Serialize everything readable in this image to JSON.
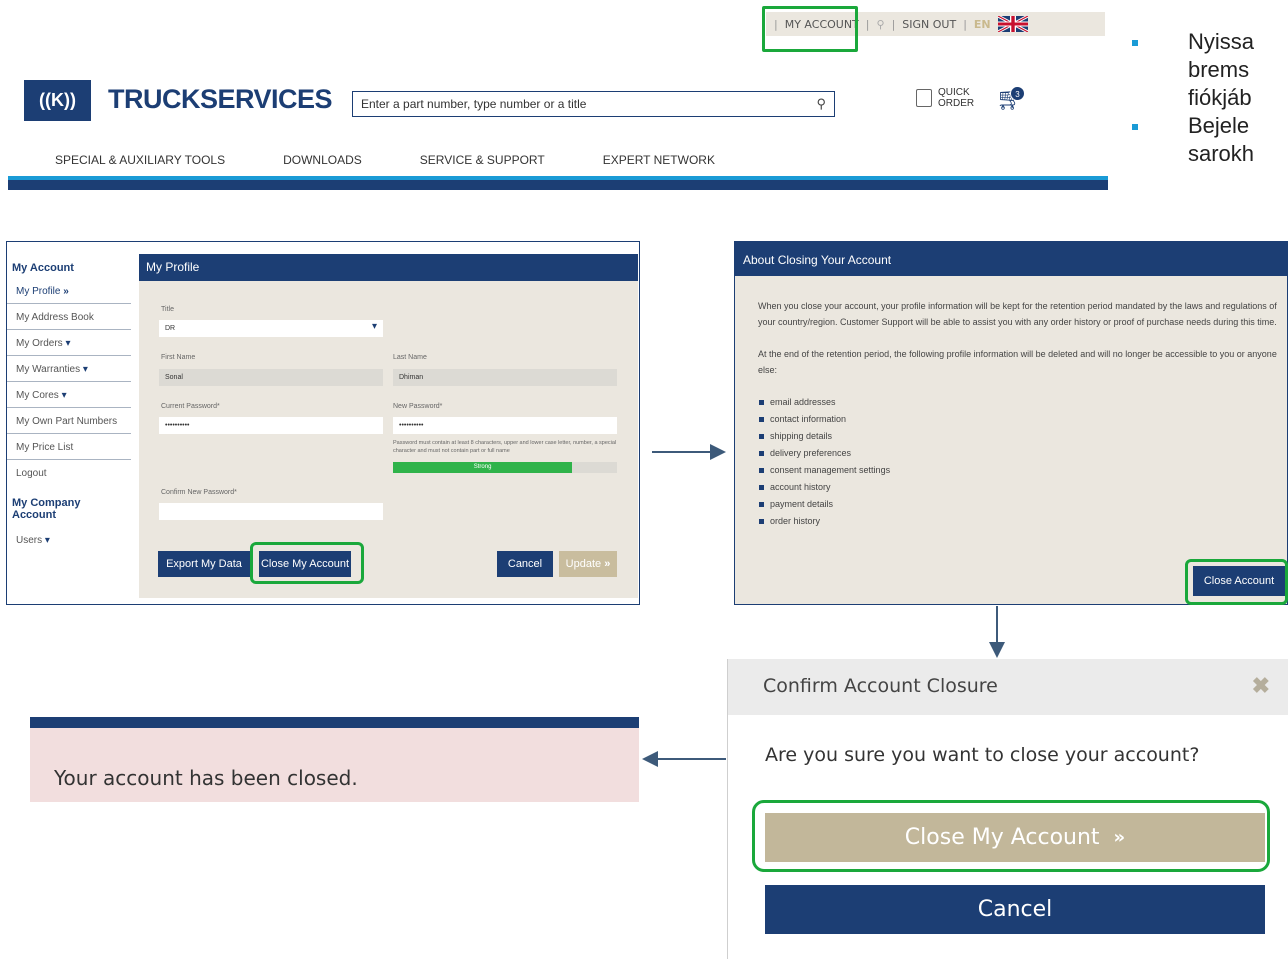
{
  "utility": {
    "my_account": "MY ACCOUNT",
    "sign_out": "SIGN OUT",
    "language": "EN"
  },
  "header": {
    "brand": "TRUCKSERVICES",
    "search_placeholder": "Enter a part number, type number or a title",
    "quick_order_line1": "QUICK",
    "quick_order_line2": "ORDER",
    "cart_count": "3"
  },
  "nav": [
    "SPECIAL & AUXILIARY TOOLS",
    "DOWNLOADS",
    "SERVICE & SUPPORT",
    "EXPERT NETWORK"
  ],
  "bullets": [
    "Nyissa",
    "brems",
    "fiókjáb",
    "Bejele",
    "sarokh"
  ],
  "profile": {
    "sidebar_title": "My Account",
    "sidebar_items": [
      "My Profile",
      "My Address Book",
      "My Orders",
      "My Warranties",
      "My Cores",
      "My Own Part Numbers",
      "My Price List",
      "Logout"
    ],
    "company_title": "My Company Account",
    "company_items": [
      "Users"
    ],
    "title": "My Profile",
    "title_label": "Title",
    "title_value": "DR",
    "first_name_label": "First Name",
    "first_name_value": "Sonal",
    "last_name_label": "Last Name",
    "last_name_value": "Dhiman",
    "current_password_label": "Current Password*",
    "current_password_value": "••••••••••",
    "new_password_label": "New Password*",
    "new_password_value": "••••••••••",
    "password_hint": "Password must contain at least 8 characters, upper and lower case letter, number, a special character and must not contain part or full name",
    "strength_label": "Strong",
    "strength_fraction": 0.8,
    "confirm_password_label": "Confirm New Password*",
    "export_button": "Export My Data",
    "close_button": "Close My Account",
    "cancel_button": "Cancel",
    "update_button": "Update"
  },
  "about": {
    "title": "About Closing Your Account",
    "para1": "When you close your account, your profile information will be kept for the retention period mandated by the laws and regulations of your country/region. Customer Support will be able to assist you with any order history or proof of purchase needs during this time.",
    "para2": "At the end of the retention period, the following profile information will be deleted and will no longer be accessible to you or anyone else:",
    "items": [
      "email addresses",
      "contact information",
      "shipping details",
      "delivery preferences",
      "consent management settings",
      "account history",
      "payment details",
      "order history"
    ],
    "close_button": "Close Account"
  },
  "confirm": {
    "title": "Confirm Account Closure",
    "question": "Are you sure you want to close your account?",
    "close_button": "Close My Account",
    "cancel_button": "Cancel"
  },
  "closed_message": "Your account has been closed.",
  "colors": {
    "navy": "#1c3e74",
    "highlight_green": "#1aa83b",
    "tan": "#c9bd9e",
    "panel_beige": "#ebe7df",
    "alert_pink": "#f2dede"
  }
}
